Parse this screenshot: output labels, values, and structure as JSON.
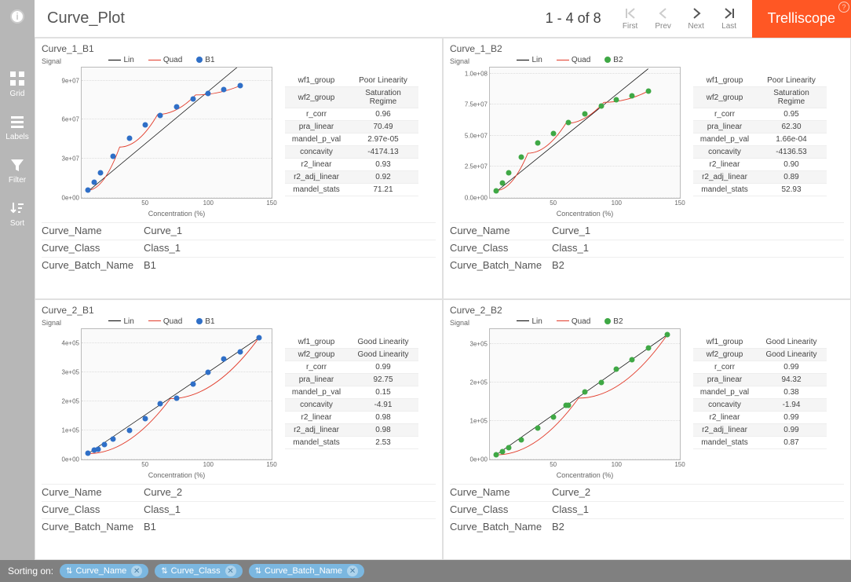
{
  "header": {
    "title": "Curve_Plot",
    "pager_text": "1 - 4 of 8",
    "pager": {
      "first": "First",
      "prev": "Prev",
      "next": "Next",
      "last": "Last"
    },
    "brand": "Trelliscope"
  },
  "rail": {
    "grid": "Grid",
    "labels": "Labels",
    "filter": "Filter",
    "sort": "Sort"
  },
  "footer": {
    "label": "Sorting on:",
    "chips": [
      "Curve_Name",
      "Curve_Class",
      "Curve_Batch_Name"
    ]
  },
  "colors": {
    "b1": "#2f6fc7",
    "b2": "#3fa845",
    "lin": "#000000",
    "quad": "#e23b2a"
  },
  "panels": [
    {
      "title": "Curve_1_B1",
      "batch": "B1",
      "meta": {
        "Curve_Name": "Curve_1",
        "Curve_Class": "Class_1",
        "Curve_Batch_Name": "B1"
      },
      "stats": {
        "wf1_group": "Poor Linearity",
        "wf2_group": "Saturation Regime",
        "r_corr": "0.96",
        "pra_linear": "70.49",
        "mandel_p_val": "2.97e-05",
        "concavity": "-4174.13",
        "r2_linear": "0.93",
        "r2_adj_linear": "0.92",
        "mandel_stats": "71.21"
      }
    },
    {
      "title": "Curve_1_B2",
      "batch": "B2",
      "meta": {
        "Curve_Name": "Curve_1",
        "Curve_Class": "Class_1",
        "Curve_Batch_Name": "B2"
      },
      "stats": {
        "wf1_group": "Poor Linearity",
        "wf2_group": "Saturation Regime",
        "r_corr": "0.95",
        "pra_linear": "62.30",
        "mandel_p_val": "1.66e-04",
        "concavity": "-4136.53",
        "r2_linear": "0.90",
        "r2_adj_linear": "0.89",
        "mandel_stats": "52.93"
      }
    },
    {
      "title": "Curve_2_B1",
      "batch": "B1",
      "meta": {
        "Curve_Name": "Curve_2",
        "Curve_Class": "Class_1",
        "Curve_Batch_Name": "B1"
      },
      "stats": {
        "wf1_group": "Good Linearity",
        "wf2_group": "Good Linearity",
        "r_corr": "0.99",
        "pra_linear": "92.75",
        "mandel_p_val": "0.15",
        "concavity": "-4.91",
        "r2_linear": "0.98",
        "r2_adj_linear": "0.98",
        "mandel_stats": "2.53"
      }
    },
    {
      "title": "Curve_2_B2",
      "batch": "B2",
      "meta": {
        "Curve_Name": "Curve_2",
        "Curve_Class": "Class_1",
        "Curve_Batch_Name": "B2"
      },
      "stats": {
        "wf1_group": "Good Linearity",
        "wf2_group": "Good Linearity",
        "r_corr": "0.99",
        "pra_linear": "94.32",
        "mandel_p_val": "0.38",
        "concavity": "-1.94",
        "r2_linear": "0.99",
        "r2_adj_linear": "0.99",
        "mandel_stats": "0.87"
      }
    }
  ],
  "chart_data": [
    {
      "type": "scatter",
      "title": "Curve_1_B1",
      "xlabel": "Concentration (%)",
      "ylabel": "Signal",
      "xlim": [
        0,
        150
      ],
      "ylim": [
        0,
        100000000.0
      ],
      "xticks": [
        50,
        100,
        150
      ],
      "yticks_labels": [
        "0e+00",
        "3e+07",
        "6e+07",
        "9e+07"
      ],
      "yticks": [
        0,
        30000000.0,
        60000000.0,
        90000000.0
      ],
      "legend": [
        "Lin",
        "Quad",
        "B1"
      ],
      "series": [
        {
          "name": "B1",
          "kind": "points",
          "color": "#2f6fc7",
          "x": [
            5,
            10,
            15,
            25,
            38,
            50,
            62,
            75,
            88,
            100,
            112,
            125
          ],
          "y": [
            6000000.0,
            12000000.0,
            19000000.0,
            32000000.0,
            46000000.0,
            56000000.0,
            63000000.0,
            70000000.0,
            76000000.0,
            80000000.0,
            83000000.0,
            86000000.0
          ]
        },
        {
          "name": "Lin",
          "kind": "line",
          "color": "#000000",
          "x1": 5,
          "y1": 5000000.0,
          "x2": 125,
          "y2": 102000000.0
        },
        {
          "name": "Quad",
          "kind": "curve",
          "color": "#e23b2a",
          "x": [
            5,
            30,
            60,
            90,
            125
          ],
          "y": [
            6000000.0,
            39000000.0,
            64000000.0,
            79000000.0,
            86000000.0
          ]
        }
      ]
    },
    {
      "type": "scatter",
      "title": "Curve_1_B2",
      "xlabel": "Concentration (%)",
      "ylabel": "Signal",
      "xlim": [
        0,
        150
      ],
      "ylim": [
        0,
        105000000.0
      ],
      "xticks": [
        50,
        100,
        150
      ],
      "yticks_labels": [
        "0.0e+00",
        "2.5e+07",
        "5.0e+07",
        "7.5e+07",
        "1.0e+08"
      ],
      "yticks": [
        0,
        25000000.0,
        50000000.0,
        75000000.0,
        100000000.0
      ],
      "legend": [
        "Lin",
        "Quad",
        "B2"
      ],
      "series": [
        {
          "name": "B2",
          "kind": "points",
          "color": "#3fa845",
          "x": [
            5,
            10,
            15,
            25,
            38,
            50,
            62,
            75,
            88,
            100,
            112,
            125
          ],
          "y": [
            6000000.0,
            12000000.0,
            20000000.0,
            33000000.0,
            44000000.0,
            52000000.0,
            61000000.0,
            68000000.0,
            74000000.0,
            79000000.0,
            82000000.0,
            86000000.0
          ]
        },
        {
          "name": "Lin",
          "kind": "line",
          "color": "#000000",
          "x1": 5,
          "y1": 5000000.0,
          "x2": 125,
          "y2": 104000000.0
        },
        {
          "name": "Quad",
          "kind": "curve",
          "color": "#e23b2a",
          "x": [
            5,
            30,
            60,
            90,
            125
          ],
          "y": [
            6000000.0,
            36000000.0,
            60000000.0,
            77000000.0,
            86000000.0
          ]
        }
      ]
    },
    {
      "type": "scatter",
      "title": "Curve_2_B1",
      "xlabel": "Concentration (%)",
      "ylabel": "Signal",
      "xlim": [
        0,
        150
      ],
      "ylim": [
        0,
        450000.0
      ],
      "xticks": [
        50,
        100,
        150
      ],
      "yticks_labels": [
        "0e+00",
        "1e+05",
        "2e+05",
        "3e+05",
        "4e+05"
      ],
      "yticks": [
        0,
        100000.0,
        200000.0,
        300000.0,
        400000.0
      ],
      "legend": [
        "Lin",
        "Quad",
        "B1"
      ],
      "series": [
        {
          "name": "B1",
          "kind": "points",
          "color": "#2f6fc7",
          "x": [
            5,
            10,
            13,
            18,
            25,
            38,
            50,
            62,
            75,
            88,
            100,
            112,
            125,
            140
          ],
          "y": [
            20000.0,
            30000.0,
            35000.0,
            50000.0,
            70000.0,
            100000.0,
            140000.0,
            190000.0,
            210000.0,
            260000.0,
            300000.0,
            345000.0,
            370000.0,
            420000.0
          ]
        },
        {
          "name": "Lin",
          "kind": "line",
          "color": "#000000",
          "x1": 5,
          "y1": 20000.0,
          "x2": 140,
          "y2": 420000.0
        },
        {
          "name": "Quad",
          "kind": "curve",
          "color": "#e23b2a",
          "x": [
            5,
            70,
            140
          ],
          "y": [
            20000.0,
            210000.0,
            420000.0
          ]
        }
      ]
    },
    {
      "type": "scatter",
      "title": "Curve_2_B2",
      "xlabel": "Concentration (%)",
      "ylabel": "Signal",
      "xlim": [
        0,
        150
      ],
      "ylim": [
        0,
        340000.0
      ],
      "xticks": [
        50,
        100,
        150
      ],
      "yticks_labels": [
        "0e+00",
        "1e+05",
        "2e+05",
        "3e+05"
      ],
      "yticks": [
        0,
        100000.0,
        200000.0,
        300000.0
      ],
      "legend": [
        "Lin",
        "Quad",
        "B2"
      ],
      "series": [
        {
          "name": "B2",
          "kind": "points",
          "color": "#3fa845",
          "x": [
            5,
            10,
            15,
            25,
            38,
            50,
            60,
            62,
            75,
            88,
            100,
            112,
            125,
            140
          ],
          "y": [
            12000.0,
            20000.0,
            30000.0,
            50000.0,
            80000.0,
            110000.0,
            140000.0,
            140000.0,
            175000.0,
            200000.0,
            235000.0,
            260000.0,
            290000.0,
            325000.0
          ]
        },
        {
          "name": "Lin",
          "kind": "line",
          "color": "#000000",
          "x1": 5,
          "y1": 12000.0,
          "x2": 140,
          "y2": 325000.0
        },
        {
          "name": "Quad",
          "kind": "curve",
          "color": "#e23b2a",
          "x": [
            5,
            70,
            140
          ],
          "y": [
            12000.0,
            160000.0,
            325000.0
          ]
        }
      ]
    }
  ],
  "stat_keys": [
    "wf1_group",
    "wf2_group",
    "r_corr",
    "pra_linear",
    "mandel_p_val",
    "concavity",
    "r2_linear",
    "r2_adj_linear",
    "mandel_stats"
  ],
  "meta_keys": [
    "Curve_Name",
    "Curve_Class",
    "Curve_Batch_Name"
  ]
}
